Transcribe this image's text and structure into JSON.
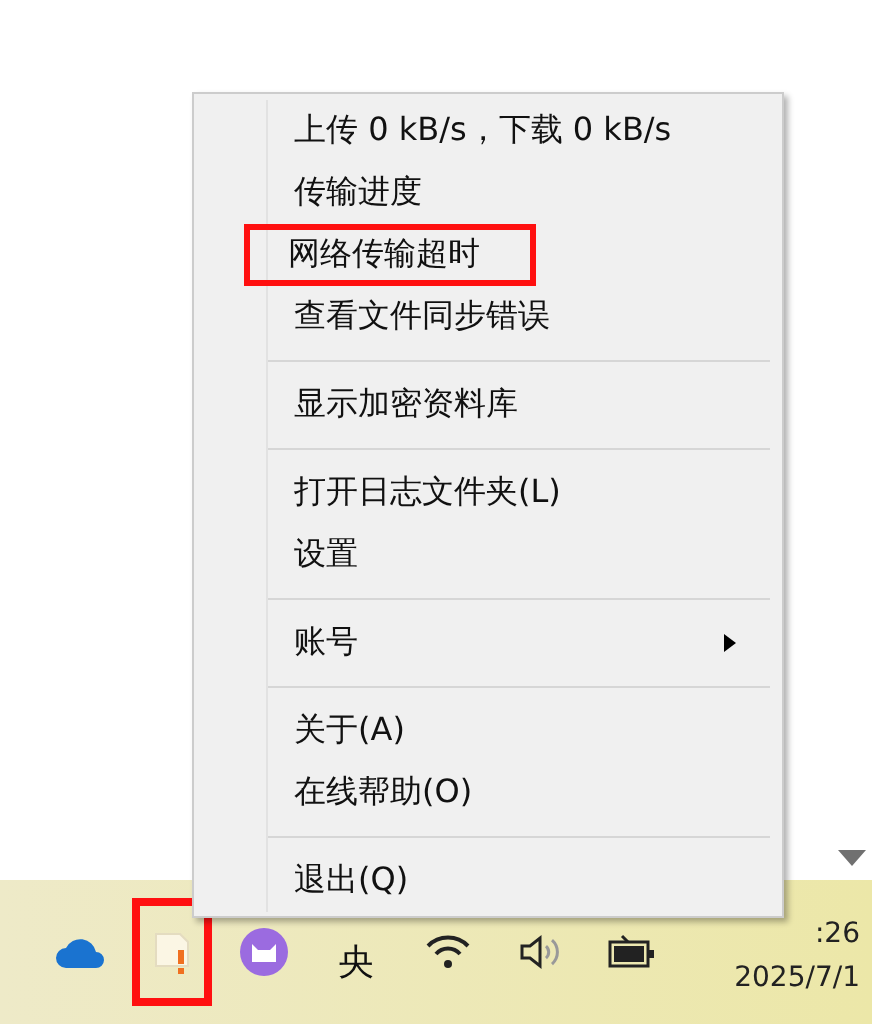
{
  "menu": {
    "items": [
      {
        "kind": "item",
        "label": "上传 0 kB/s，下载 0 kB/s",
        "submenu": false,
        "outlined": false
      },
      {
        "kind": "item",
        "label": "传输进度",
        "submenu": false,
        "outlined": false
      },
      {
        "kind": "item",
        "label": "网络传输超时",
        "submenu": false,
        "outlined": true
      },
      {
        "kind": "item",
        "label": "查看文件同步错误",
        "submenu": false,
        "outlined": false
      },
      {
        "kind": "separator"
      },
      {
        "kind": "item",
        "label": "显示加密资料库",
        "submenu": false,
        "outlined": false
      },
      {
        "kind": "separator"
      },
      {
        "kind": "item",
        "label": "打开日志文件夹(L)",
        "submenu": false,
        "outlined": false
      },
      {
        "kind": "item",
        "label": "设置",
        "submenu": false,
        "outlined": false
      },
      {
        "kind": "separator"
      },
      {
        "kind": "item",
        "label": "账号",
        "submenu": true,
        "outlined": false
      },
      {
        "kind": "separator"
      },
      {
        "kind": "item",
        "label": "关于(A)",
        "submenu": false,
        "outlined": false
      },
      {
        "kind": "item",
        "label": "在线帮助(O)",
        "submenu": false,
        "outlined": false
      },
      {
        "kind": "separator"
      },
      {
        "kind": "item",
        "label": "退出(Q)",
        "submenu": false,
        "outlined": false
      }
    ]
  },
  "taskbar": {
    "tray": [
      {
        "kind": "cloud",
        "outlined": false
      },
      {
        "kind": "sync-warning",
        "outlined": true
      },
      {
        "kind": "cat",
        "outlined": false
      },
      {
        "kind": "ime",
        "label": "央",
        "outlined": false
      },
      {
        "kind": "wifi",
        "outlined": false
      },
      {
        "kind": "speaker",
        "outlined": false
      },
      {
        "kind": "battery",
        "outlined": false
      }
    ],
    "time": ":26",
    "date": "2025/7/1"
  }
}
